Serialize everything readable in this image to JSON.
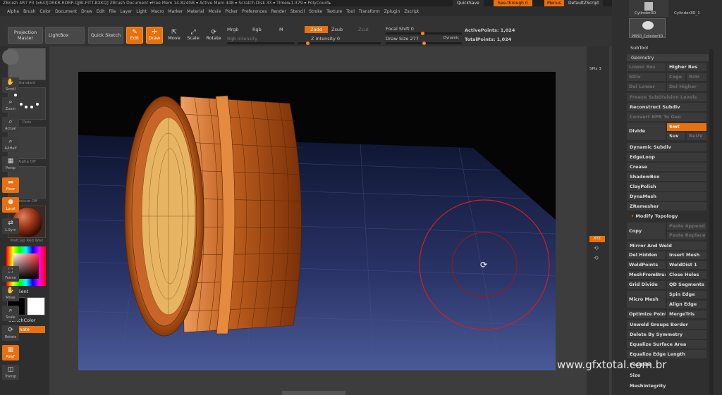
{
  "titlebar": {
    "text": "ZBrush 4R7 P3 (x64)[DRKR-RDRP-QJBI-FITT-BXKQ]   ZBrush Document   ▾Free Mem 14.824GB ▾ Active Mem 448 ▾ Scratch Disk 33 ▾ Timer▸1.379 ▾ PolyCount▸",
    "quicksave": "QuickSave",
    "seethrough": "See-through  0",
    "menus": "Menus",
    "script": "DefaultZScript"
  },
  "menubar": {
    "items": [
      "Alpha",
      "Brush",
      "Color",
      "Document",
      "Draw",
      "Edit",
      "File",
      "Layer",
      "Light",
      "Macro",
      "Marker",
      "Material",
      "Movie",
      "Picker",
      "Preferences",
      "Render",
      "Stencil",
      "Stroke",
      "Texture",
      "Tool",
      "Transform",
      "Zplugin",
      "Zscript"
    ]
  },
  "toolbar": {
    "projection_master": "Projection Master",
    "lightbox": "LightBox",
    "quick_sketch": "Quick Sketch",
    "edit": "Edit",
    "draw": "Draw",
    "move": "Move",
    "scale": "Scale",
    "rotate": "Rotate",
    "mrgb": "Mrgb",
    "rgb": "Rgb",
    "m": "M",
    "zadd": "Zadd",
    "zsub": "Zsub",
    "zcut": "Zcut",
    "rgb_intensity": "Rgb Intensity",
    "z_intensity": "Z Intensity 0",
    "focal_shift": "Focal Shift 0",
    "draw_size": "Draw Size 277",
    "dynamic": "Dynamic",
    "active_points": "ActivePoints: 1,024",
    "total_points": "TotalPoints: 1,024",
    "accent": "#e8700f"
  },
  "leftshelf": {
    "labels": [
      "Standard",
      "Dots",
      "Alpha Off",
      "Texture Off",
      "MatCap Red Wax"
    ],
    "gradient": "Gradient",
    "switch_color": "SwitchColor",
    "alternate": "Alternate"
  },
  "rightshelf": {
    "items": [
      "SPix 3",
      "Scroll",
      "Zoom",
      "Actual",
      "AAHalf",
      "Persp",
      "Floor",
      "Local",
      "L.Sym",
      "XYZ",
      "Frame",
      "Move",
      "Scale",
      "Rotate",
      "PolyF",
      "Transp"
    ]
  },
  "rightpanel": {
    "tool_thumbs": [
      "Cylinder3D",
      "Cylinder3D_1",
      "PM3D_Cylinder3D"
    ],
    "subtool": "SubTool",
    "geometry": "Geometry",
    "lower_res": "Lower Res",
    "higher_res": "Higher Res",
    "sdiv": "SDiv",
    "cage": "Cage",
    "rstr": "Rstr",
    "del_lower": "Del Lower",
    "del_higher": "Del Higher",
    "freeze_subdiv": "Freeze SubDivision Levels",
    "reconstruct_subdiv": "Reconstruct Subdiv",
    "convert_bpr": "Convert BPR To Geo",
    "divide": "Divide",
    "smt": "Smt",
    "suv": "Suv",
    "relax": "ReUV",
    "dynamic_subdiv": "Dynamic Subdiv",
    "edgeloop": "EdgeLoop",
    "crease": "Crease",
    "shadowbox": "ShadowBox",
    "claypolish": "ClayPolish",
    "dynamesh": "DynaMesh",
    "zremesher": "ZRemesher",
    "modify_topology": "Modify Topology",
    "copy": "Copy",
    "paste_append": "Paste Append",
    "paste_replace": "Paste Replace",
    "mirror_weld": "Mirror And Weld",
    "del_hidden": "Del Hidden",
    "insert_mesh": "Insert Mesh",
    "weldpoints": "WeldPoints",
    "welddist": "WeldDist 1",
    "meshfrombrush": "MeshFromBrush",
    "close_holes": "Close Holes",
    "grid_divide": "Grid Divide",
    "qd_segments": "QD Segments",
    "micro_mesh": "Micro Mesh",
    "spin_edge": "Spin Edge",
    "align_edge": "Align Edge",
    "optimize_points": "Optimize Points",
    "mergetris": "MergeTris",
    "unweld_groups": "Unweld Groups Border",
    "delete_symmetry": "Delete By Symmetry",
    "equalize_area": "Equalize Surface Area",
    "equalize_edge": "Equalize Edge Length",
    "position": "Position",
    "size": "Size",
    "meshintegrity": "MeshIntegrity"
  },
  "watermark": "www.gfxtotal.com.br"
}
